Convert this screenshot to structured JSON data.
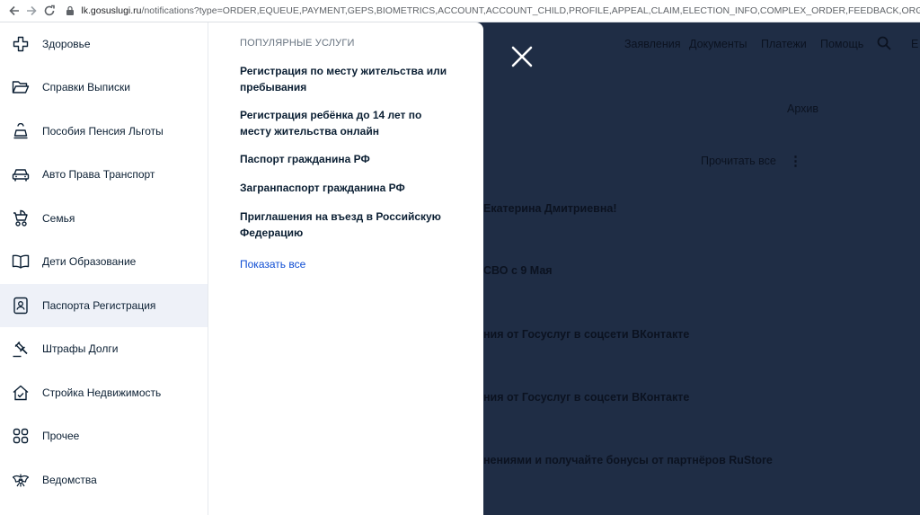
{
  "browser": {
    "url_host": "lk.gosuslugi.ru",
    "url_path": "/notifications?type=ORDER,EQUEUE,PAYMENT,GEPS,BIOMETRICS,ACCOUNT,ACCOUNT_CHILD,PROFILE,APPEAL,CLAIM,ELECTION_INFO,COMPLEX_ORDER,FEEDBACK,ORGANIZATION,BUSINESSM"
  },
  "header": {
    "nav": [
      "Заявления",
      "Документы",
      "Платежи",
      "Помощь"
    ],
    "user_initial": "Е"
  },
  "background": {
    "archive_label": "Архив",
    "mark_all_read": "Прочитать все",
    "rows": [
      "Екатерина Дмитриевна!",
      "СВО с 9 Мая",
      "ния от Госуслуг в соцсети ВКонтакте",
      "ния от Госуслуг в соцсети ВКонтакте",
      "нениями и получайте бонусы от партнёров RuStore"
    ]
  },
  "menu": {
    "items": [
      {
        "label": "Здоровье",
        "icon": "health-cross-icon"
      },
      {
        "label": "Справки Выписки",
        "icon": "folder-icon"
      },
      {
        "label": "Пособия Пенсия Льготы",
        "icon": "benefits-bell-icon"
      },
      {
        "label": "Авто Права Транспорт",
        "icon": "car-icon"
      },
      {
        "label": "Семья",
        "icon": "stroller-icon"
      },
      {
        "label": "Дети Образование",
        "icon": "book-icon"
      },
      {
        "label": "Паспорта Регистрация",
        "icon": "passport-icon"
      },
      {
        "label": "Штрафы Долги",
        "icon": "gavel-icon"
      },
      {
        "label": "Стройка Недвижимость",
        "icon": "house-icon"
      },
      {
        "label": "Прочее",
        "icon": "grid-icon"
      },
      {
        "label": "Ведомства",
        "icon": "coat-of-arms-icon"
      }
    ],
    "active_index": 6
  },
  "services": {
    "title": "ПОПУЛЯРНЫЕ УСЛУГИ",
    "items": [
      "Регистрация по месту жительства или пребывания",
      "Регистрация ребёнка до 14 лет по месту жительства онлайн",
      "Паспорт гражданина РФ",
      "Загранпаспорт гражданина РФ",
      "Приглашения на въезд в Российскую Федерацию"
    ],
    "show_all": "Показать все"
  },
  "colors": {
    "overlay": "#1f2d45",
    "active_item_bg": "#eef1f8",
    "link": "#0d4cd3",
    "text": "#0b1f33"
  }
}
